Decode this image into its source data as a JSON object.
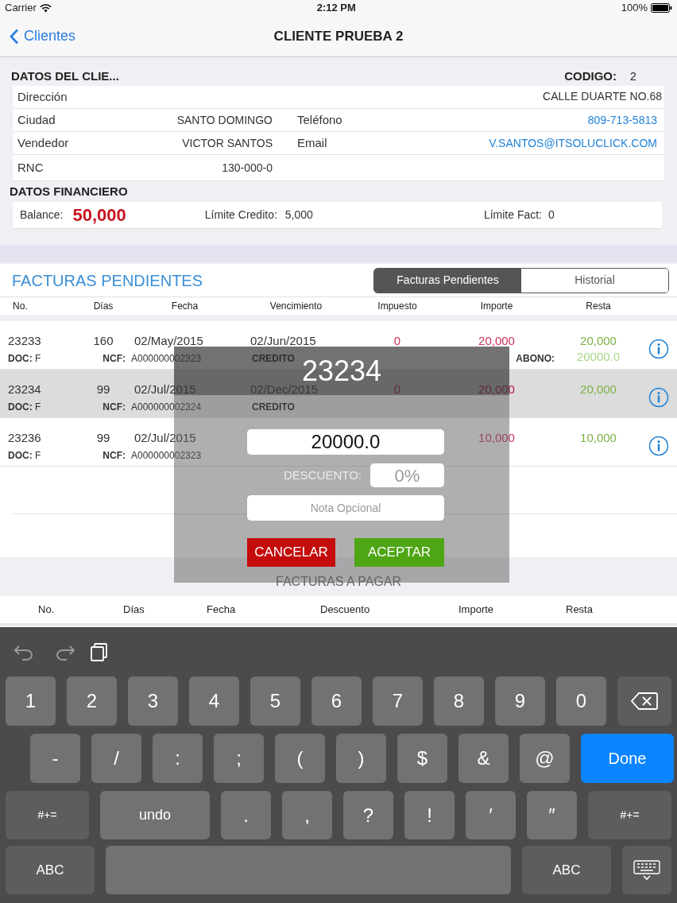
{
  "status_bar": {
    "carrier": "Carrier",
    "time": "2:12 PM",
    "battery": "100%"
  },
  "nav": {
    "back": "Clientes",
    "title": "CLIENTE PRUEBA 2"
  },
  "client": {
    "header": "DATOS DEL CLIE...",
    "code_label": "CODIGO:",
    "code": "2",
    "rows": [
      {
        "cells": [
          {
            "label": "Dirección",
            "value": "CALLE DUARTE NO.68",
            "link": false
          }
        ]
      },
      {
        "cells": [
          {
            "label": "Ciudad",
            "value": "SANTO DOMINGO",
            "link": false
          },
          {
            "label": "Teléfono",
            "value": "809-713-5813",
            "link": true
          }
        ]
      },
      {
        "cells": [
          {
            "label": "Vendedor",
            "value": "VICTOR SANTOS",
            "link": false
          },
          {
            "label": "Email",
            "value": "V.SANTOS@ITSOLUCLICK.COM",
            "link": true
          }
        ]
      },
      {
        "cells": [
          {
            "label": "RNC",
            "value": "130-000-0",
            "link": false
          }
        ]
      }
    ]
  },
  "financial": {
    "header": "DATOS FINANCIERO",
    "balance_label": "Balance:",
    "balance": "50,000",
    "credit_label": "Límite Credito:",
    "credit": "5,000",
    "invoice_limit_label": "Límite Fact:",
    "invoice_limit": "0"
  },
  "pending": {
    "title": "FACTURAS PENDIENTES",
    "segments": [
      {
        "label": "Facturas Pendientes",
        "selected": true
      },
      {
        "label": "Historial",
        "selected": false
      }
    ],
    "columns": [
      "No.",
      "Días",
      "Fecha",
      "Vencimiento",
      "Impuesto",
      "Importe",
      "Resta"
    ],
    "rows": [
      {
        "no": "23233",
        "days": "160",
        "date": "02/May/2015",
        "due": "02/Jun/2015",
        "tax": "0",
        "amount": "20,000",
        "remaining": "20,000",
        "doc_label": "DOC:",
        "doc": "F",
        "ncf_label": "NCF:",
        "ncf": "A000000002323",
        "type": "CREDITO",
        "payment_label": "ABONO:",
        "payment": "20000.0",
        "selected": false
      },
      {
        "no": "23234",
        "days": "99",
        "date": "02/Jul/2015",
        "due": "02/Dec/2015",
        "tax": "0",
        "amount": "20,000",
        "remaining": "20,000",
        "doc_label": "DOC:",
        "doc": "F",
        "ncf_label": "NCF:",
        "ncf": "A000000002324",
        "type": "CREDITO",
        "selected": true
      },
      {
        "no": "23236",
        "days": "99",
        "date": "02/Jul/2015",
        "due": "",
        "tax": "",
        "amount": "10,000",
        "remaining": "10,000",
        "doc_label": "DOC:",
        "doc": "F",
        "ncf_label": "NCF:",
        "ncf": "A000000002323",
        "selected": false
      }
    ]
  },
  "to_pay": {
    "title": "FACTURAS A PAGAR",
    "columns": [
      "No.",
      "Días",
      "Fecha",
      "Descuento",
      "Importe",
      "Resta"
    ]
  },
  "dialog": {
    "title": "23234",
    "amount": "20000.0",
    "discount_label": "DESCUENTO:",
    "discount_placeholder": "0%",
    "note_placeholder": "Nota Opcional",
    "cancel": "CANCELAR",
    "accept": "ACEPTAR"
  },
  "keyboard": {
    "rows": [
      [
        {
          "kind": "char",
          "label": "1"
        },
        {
          "kind": "char",
          "label": "2"
        },
        {
          "kind": "char",
          "label": "3"
        },
        {
          "kind": "char",
          "label": "4"
        },
        {
          "kind": "char",
          "label": "5"
        },
        {
          "kind": "char",
          "label": "6"
        },
        {
          "kind": "char",
          "label": "7"
        },
        {
          "kind": "char",
          "label": "8"
        },
        {
          "kind": "char",
          "label": "9"
        },
        {
          "kind": "char",
          "label": "0"
        },
        {
          "kind": "delete"
        }
      ],
      [
        {
          "kind": "char",
          "label": "-"
        },
        {
          "kind": "char",
          "label": "/"
        },
        {
          "kind": "char",
          "label": ":"
        },
        {
          "kind": "char",
          "label": ";"
        },
        {
          "kind": "char",
          "label": "("
        },
        {
          "kind": "char",
          "label": ")"
        },
        {
          "kind": "char",
          "label": "$"
        },
        {
          "kind": "char",
          "label": "&"
        },
        {
          "kind": "char",
          "label": "@"
        },
        {
          "kind": "done",
          "label": "Done"
        }
      ],
      [
        {
          "kind": "symbols",
          "label": "#+="
        },
        {
          "kind": "undo",
          "label": "undo"
        },
        {
          "kind": "char",
          "label": "."
        },
        {
          "kind": "char",
          "label": ","
        },
        {
          "kind": "char",
          "label": "?"
        },
        {
          "kind": "char",
          "label": "!"
        },
        {
          "kind": "char",
          "label": "′"
        },
        {
          "kind": "char",
          "label": "″"
        },
        {
          "kind": "symbols",
          "label": "#+="
        }
      ],
      [
        {
          "kind": "abc",
          "label": "ABC"
        },
        {
          "kind": "space"
        },
        {
          "kind": "abc",
          "label": "ABC"
        },
        {
          "kind": "dismiss"
        }
      ]
    ]
  }
}
